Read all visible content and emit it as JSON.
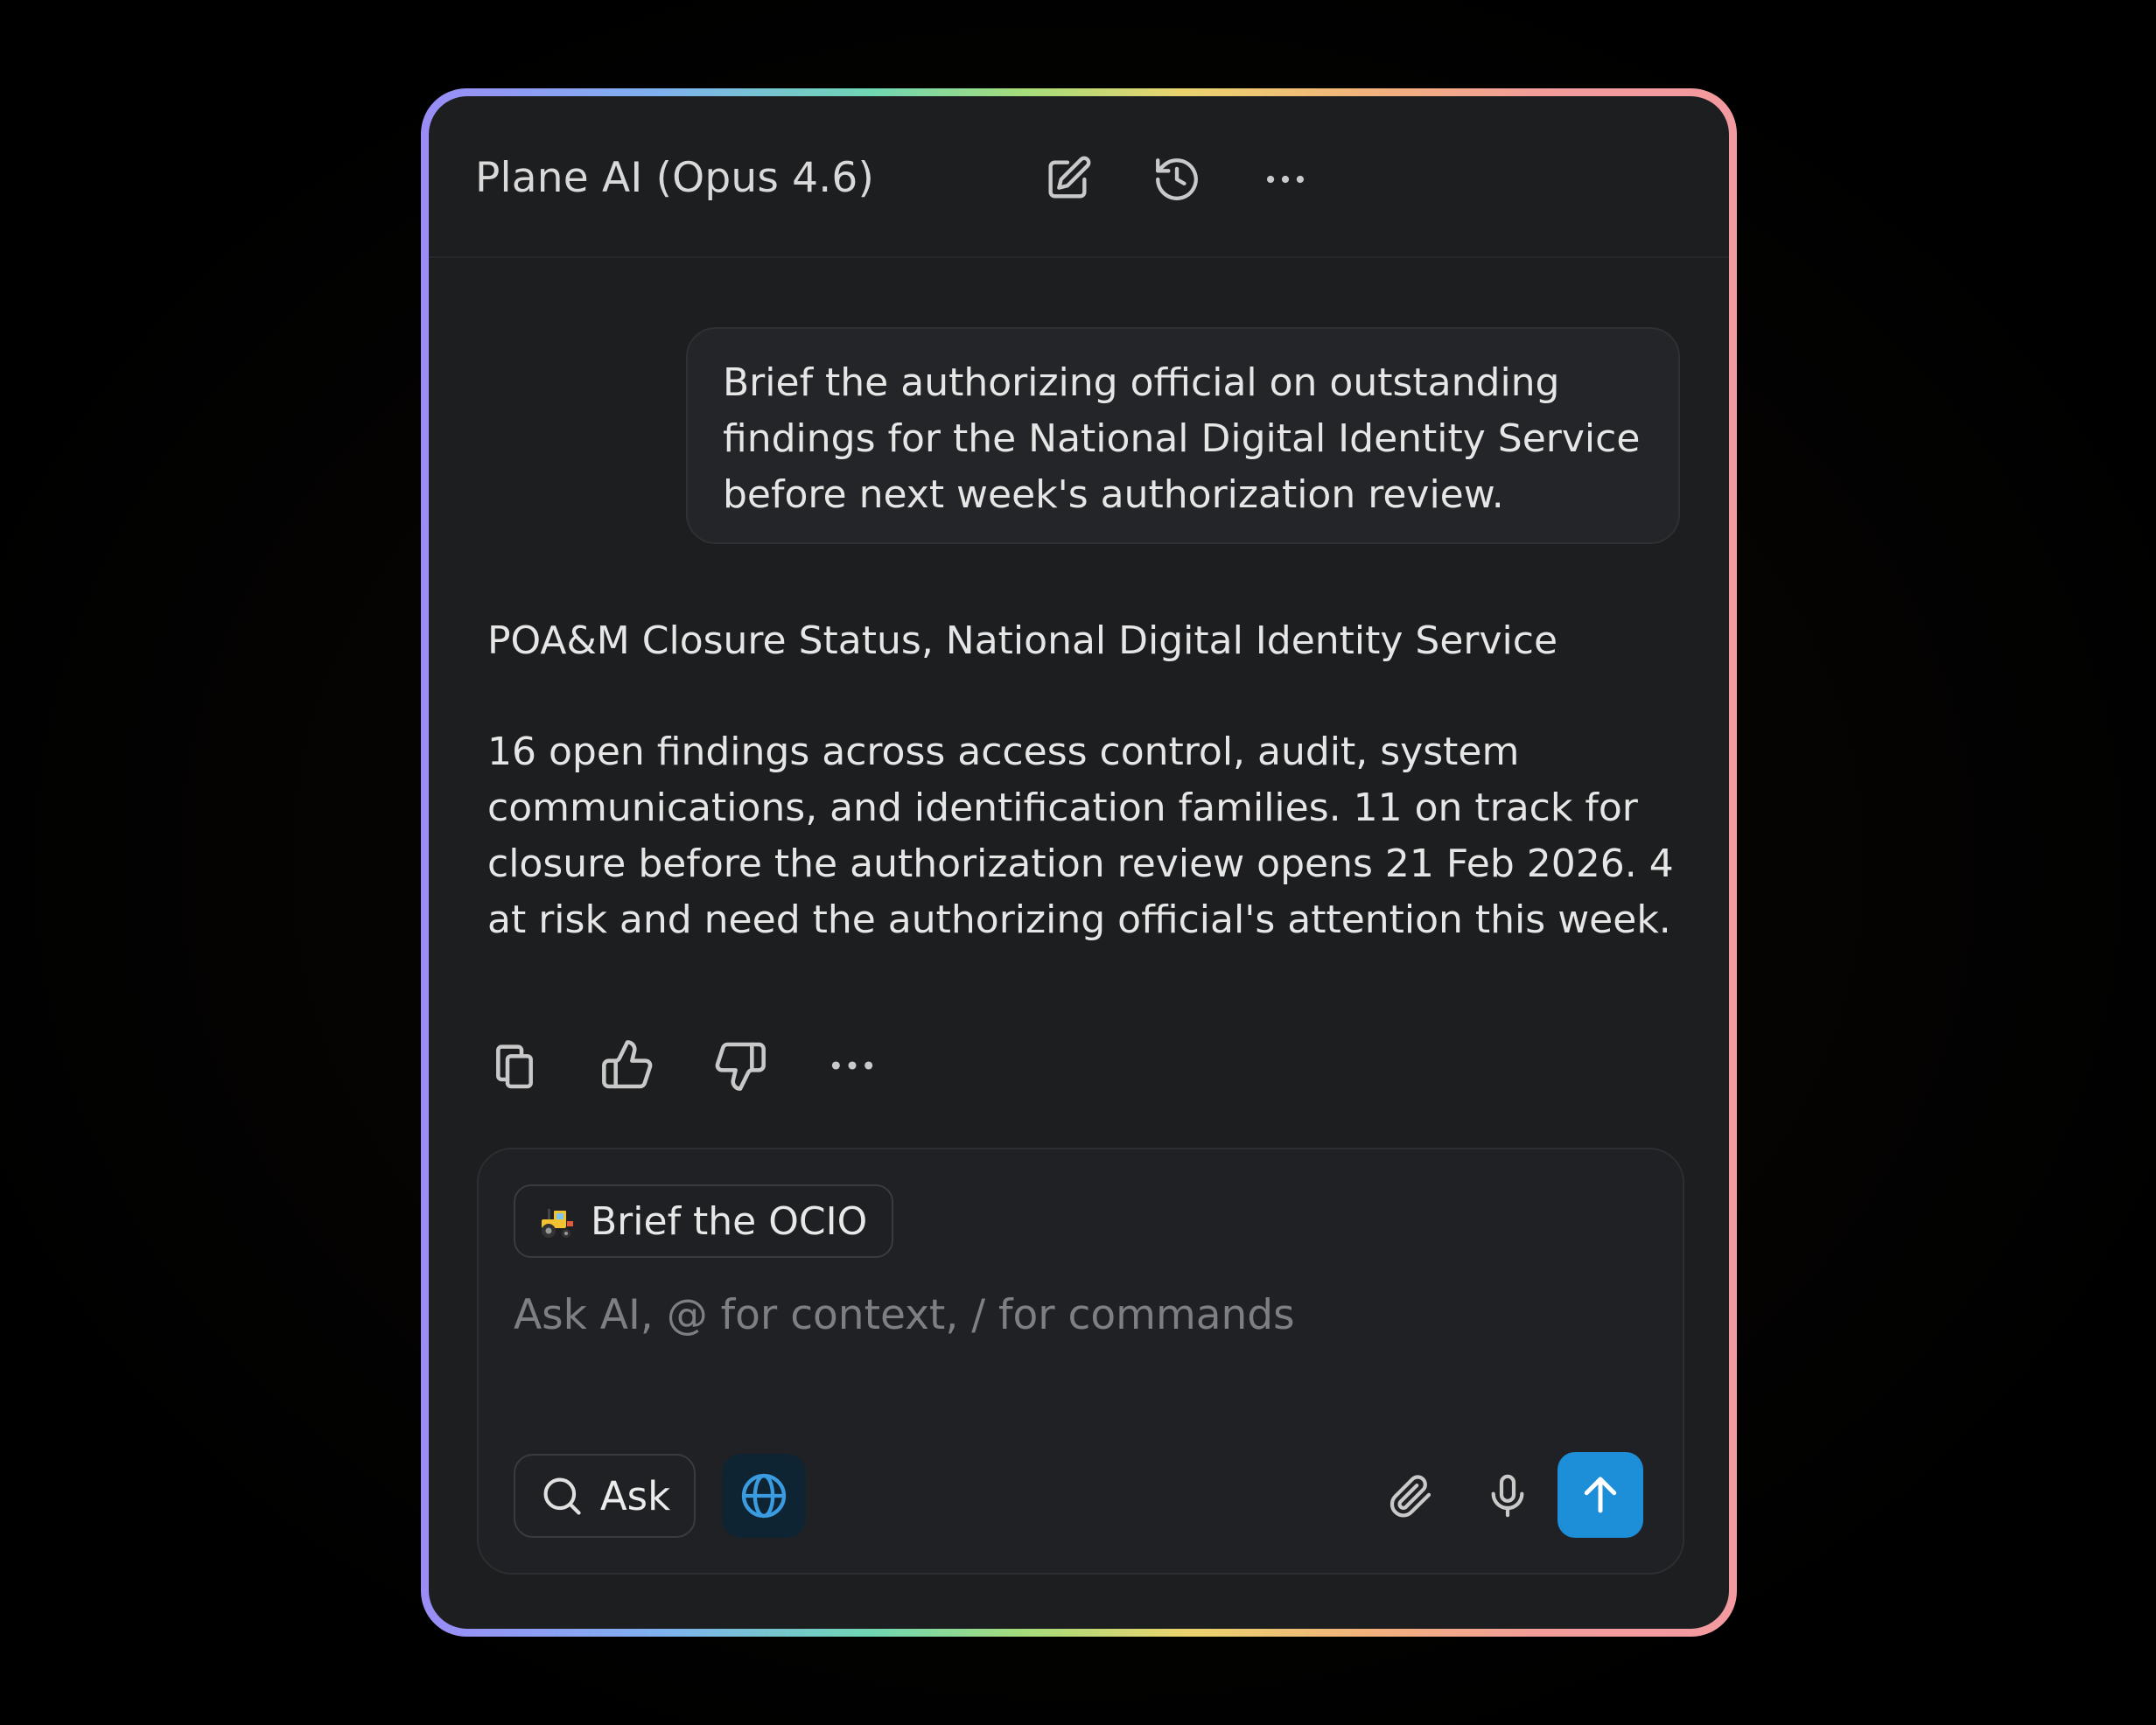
{
  "header": {
    "title": "Plane AI (Opus 4.6)",
    "icons": [
      "edit-icon",
      "history-icon",
      "more-icon"
    ]
  },
  "conversation": {
    "user_message": "Brief the authorizing official on outstanding findings for the National Digital Identity Service before next week's authorization review.",
    "response_title": "POA&M Closure Status, National Digital Identity Service",
    "response_body": "16 open findings across access control, audit, system communications, and identification families. 11 on track for closure before the authorization review opens 21 Feb 2026. 4 at risk and need the authorizing official's attention this week.",
    "feedback_icons": [
      "copy-icon",
      "thumbs-up-icon",
      "thumbs-down-icon",
      "more-icon"
    ]
  },
  "composer": {
    "chip_emoji": "tractor-icon",
    "chip_label": "Brief the OCIO",
    "placeholder": "Ask AI, @ for context, / for commands",
    "mode_label": "Ask",
    "icons": [
      "search-icon",
      "globe-icon",
      "paperclip-icon",
      "microphone-icon",
      "arrow-up-icon"
    ]
  },
  "colors": {
    "panel_background": "#1d1e20",
    "send_button": "#1d8fd8",
    "globe_accent": "#3a9be0",
    "border_gradient": [
      "#9a8cf6",
      "#6fd6b4",
      "#ead36e",
      "#f39aa0"
    ]
  }
}
